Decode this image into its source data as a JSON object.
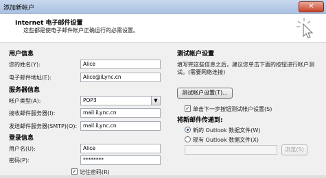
{
  "window": {
    "title": "添加新帐户",
    "close_glyph": "✕"
  },
  "header": {
    "title": "Internet 电子邮件设置",
    "subtitle": "这些都是使电子邮件帐户正确运行的必需设置。"
  },
  "user_info": {
    "section": "用户信息",
    "name_label": "您的姓名(Y):",
    "name_value": "Alice",
    "email_label": "电子邮件地址(E):",
    "email_value": "Alice@iLync.cn"
  },
  "server_info": {
    "section": "服务器信息",
    "account_type_label": "帐户类型(A):",
    "account_type_value": "POP3",
    "incoming_label": "接收邮件服务器(I):",
    "incoming_value": "mail.iLync.cn",
    "outgoing_label": "发送邮件服务器(SMTP)(O):",
    "outgoing_value": "mail.iLync.cn"
  },
  "login_info": {
    "section": "登录信息",
    "username_label": "用户名(U):",
    "username_value": "Alice",
    "password_label": "密码(P):",
    "password_value": "********",
    "remember_label": "记住密码(R)",
    "remember_checked": true
  },
  "test": {
    "section": "测试帐户设置",
    "description": "填写完这些信息之后，建议您单击下面的按钮进行帐户测试。(需要网络连接)",
    "test_button": "测试帐户设置(T)...",
    "auto_test_label": "单击下一步按钮测试帐户设置(S)",
    "auto_test_checked": true
  },
  "deliver": {
    "section": "将新邮件传递到:",
    "new_file_label": "新的 Outlook 数据文件(W)",
    "existing_file_label": "现有 Outlook 数据文件(X)",
    "existing_file_value": "",
    "browse_button": "浏览(S)",
    "selected": "new"
  },
  "icons": {
    "header_icon": "cursor-click-icon",
    "dropdown": "chevron-down-icon",
    "check": "checkmark-icon"
  }
}
